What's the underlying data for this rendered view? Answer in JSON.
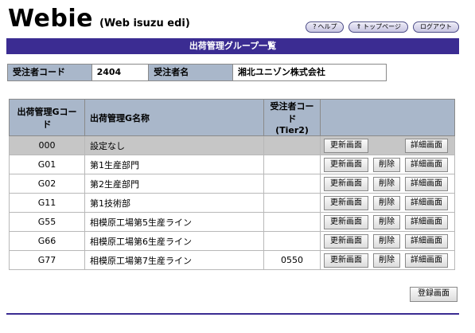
{
  "header": {
    "logo": "Webie",
    "logo_sub": "(Web isuzu edi)",
    "nav": [
      {
        "icon": "?",
        "label": "ヘルプ"
      },
      {
        "icon": "⇑",
        "label": "トップページ"
      },
      {
        "icon": "",
        "label": "ログアウト"
      }
    ]
  },
  "page_title": "出荷管理グループ一覧",
  "info": {
    "contractor_code_label": "受注者コード",
    "contractor_code": "2404",
    "contractor_name_label": "受注者名",
    "contractor_name": "湘北ユニゾン株式会社"
  },
  "table": {
    "headers": {
      "code": "出荷管理Gコード",
      "name": "出荷管理G名称",
      "tier_line1": "受注者コード",
      "tier_line2": "(Tier2)",
      "ops": ""
    },
    "rows": [
      {
        "code": "000",
        "name": "設定なし",
        "tier": "",
        "deletable": false
      },
      {
        "code": "G01",
        "name": "第1生産部門",
        "tier": "",
        "deletable": true
      },
      {
        "code": "G02",
        "name": "第2生産部門",
        "tier": "",
        "deletable": true
      },
      {
        "code": "G11",
        "name": "第1技術部",
        "tier": "",
        "deletable": true
      },
      {
        "code": "G55",
        "name": "相模原工場第5生産ライン",
        "tier": "",
        "deletable": true
      },
      {
        "code": "G66",
        "name": "相模原工場第6生産ライン",
        "tier": "",
        "deletable": true
      },
      {
        "code": "G77",
        "name": "相模原工場第7生産ライン",
        "tier": "0550",
        "deletable": true
      }
    ],
    "btn_update": "更新画面",
    "btn_delete": "削除",
    "btn_detail": "詳細画面"
  },
  "register_button": "登録画面"
}
